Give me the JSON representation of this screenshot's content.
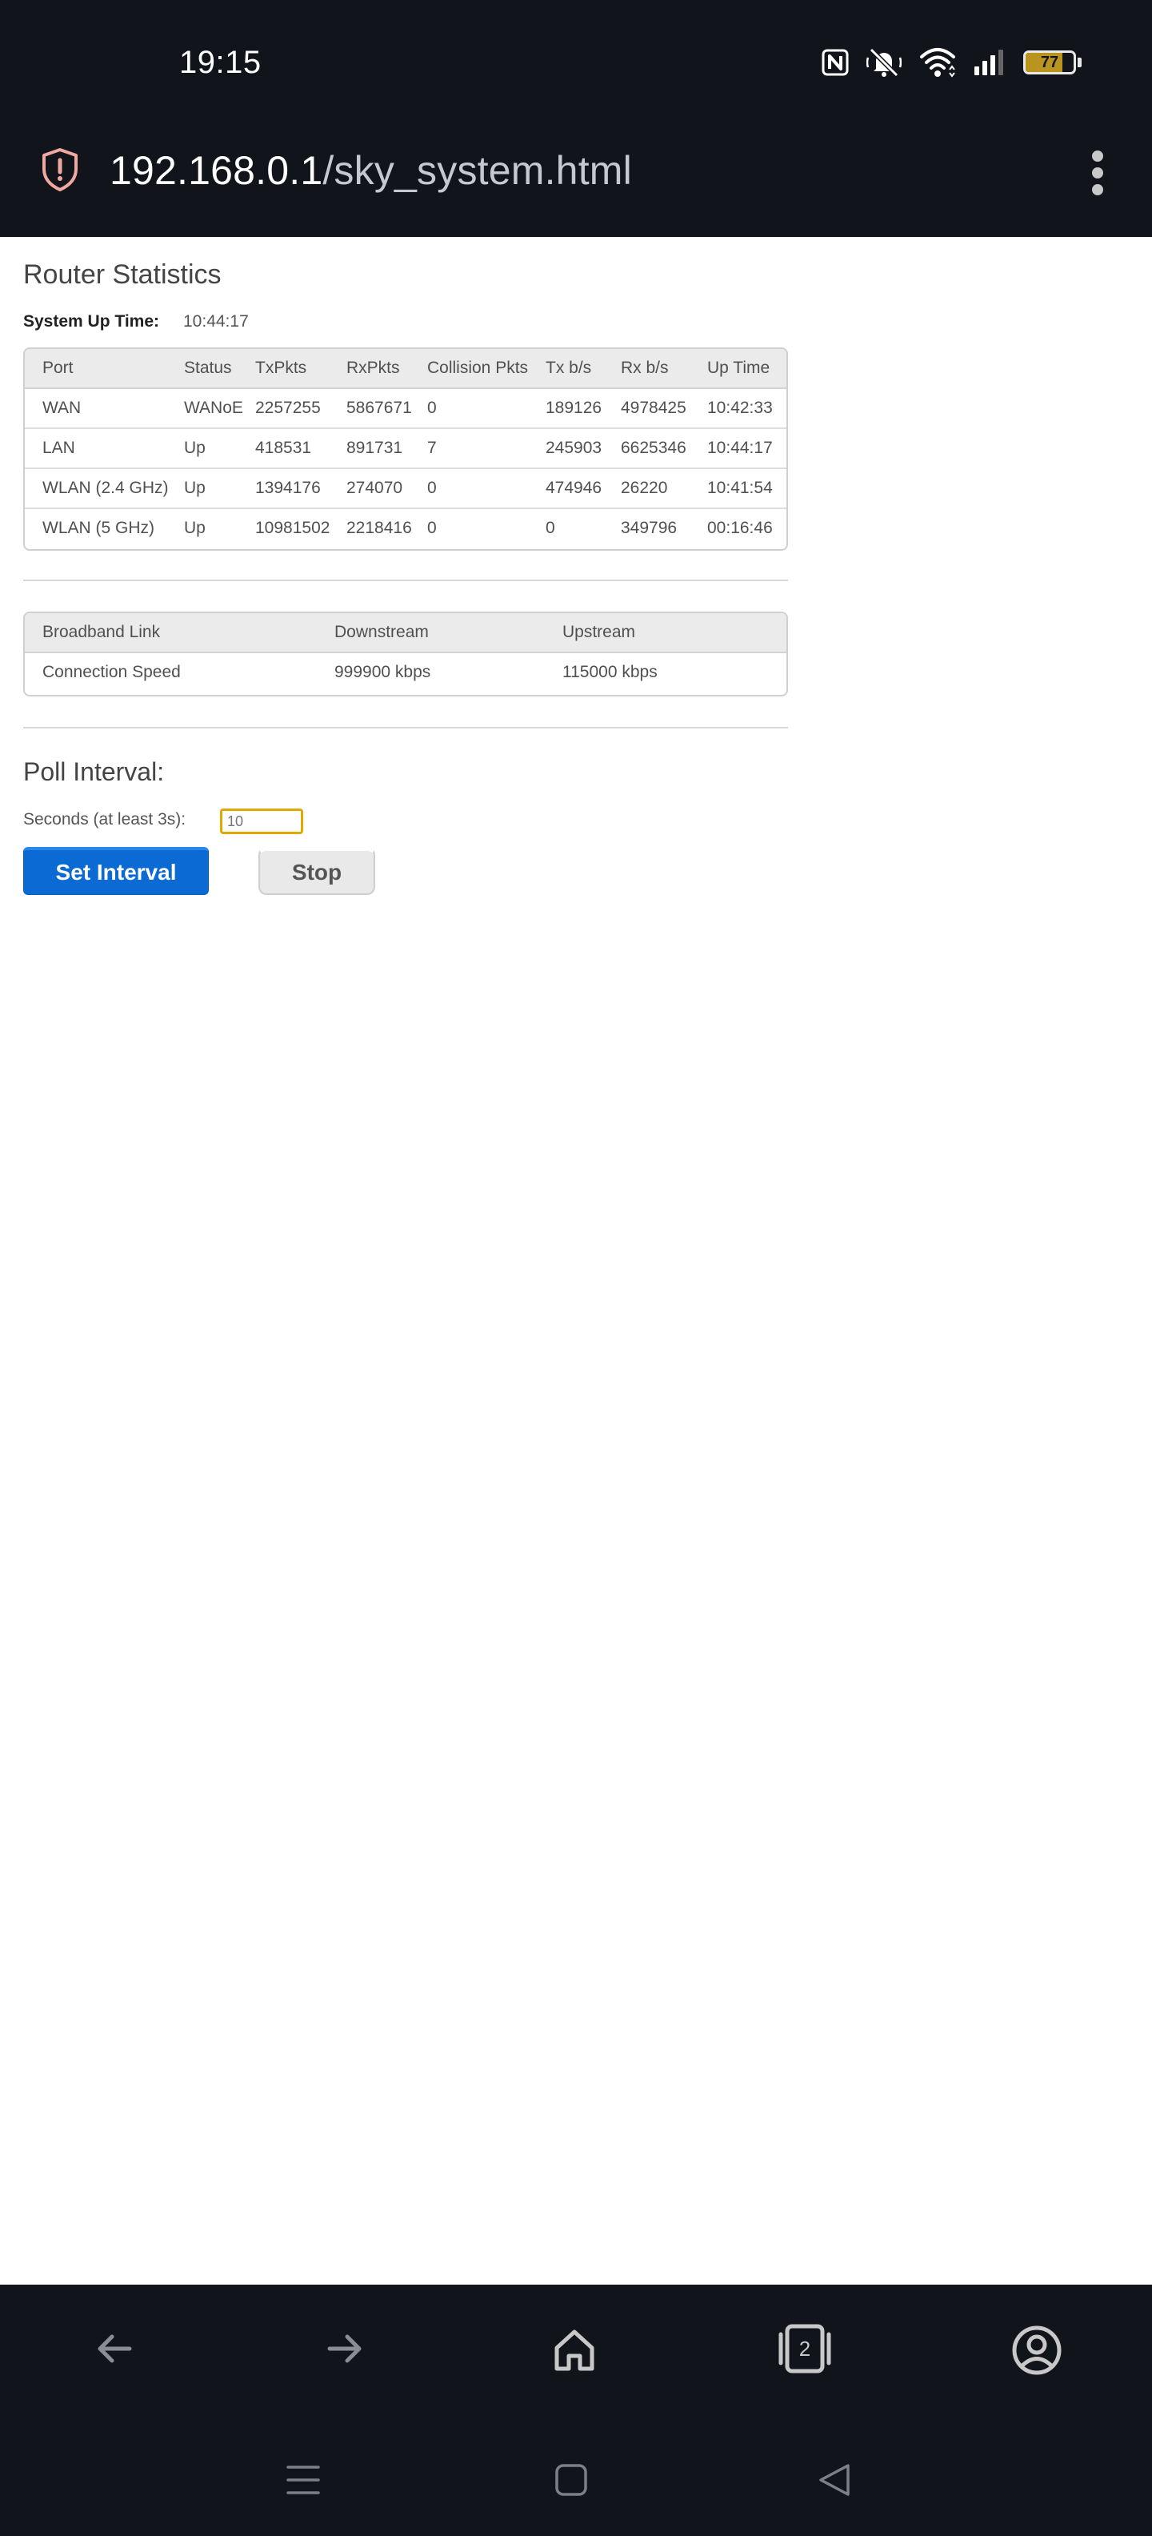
{
  "status_bar": {
    "time": "19:15",
    "battery_level": "77",
    "battery_fraction": 0.77,
    "icons": [
      "nfc-icon",
      "bell-muted-icon",
      "wifi-icon",
      "signal-icon",
      "battery-icon"
    ]
  },
  "browser": {
    "url_host": "192.168.0.1",
    "url_path": "/sky_system.html",
    "security_icon": "shield-alert-icon",
    "menu_icon": "kebab-menu-icon"
  },
  "page": {
    "title": "Router Statistics",
    "uptime_label": "System Up Time:",
    "uptime_value": "10:44:17",
    "stats_table": {
      "headers": [
        "Port",
        "Status",
        "TxPkts",
        "RxPkts",
        "Collision Pkts",
        "Tx b/s",
        "Rx b/s",
        "Up Time"
      ],
      "rows": [
        [
          "WAN",
          "WANoE",
          "2257255",
          "5867671",
          "0",
          "189126",
          "4978425",
          "10:42:33"
        ],
        [
          "LAN",
          "Up",
          "418531",
          "891731",
          "7",
          "245903",
          "6625346",
          "10:44:17"
        ],
        [
          "WLAN (2.4 GHz)",
          "Up",
          "1394176",
          "274070",
          "0",
          "474946",
          "26220",
          "10:41:54"
        ],
        [
          "WLAN (5 GHz)",
          "Up",
          "10981502",
          "2218416",
          "0",
          "0",
          "349796",
          "00:16:46"
        ]
      ]
    },
    "broadband_table": {
      "headers": [
        "Broadband Link",
        "Downstream",
        "Upstream"
      ],
      "rows": [
        [
          "Connection Speed",
          "999900 kbps",
          "115000 kbps"
        ]
      ]
    },
    "poll": {
      "title": "Poll Interval:",
      "seconds_label": "Seconds (at least 3s):",
      "seconds_placeholder": "10",
      "set_button": "Set Interval",
      "stop_button": "Stop"
    }
  },
  "bottom_nav": {
    "tab_count": "2",
    "icons": [
      "back-arrow-icon",
      "forward-arrow-icon",
      "home-icon",
      "tabs-icon",
      "account-icon"
    ]
  },
  "system_nav": {
    "icons": [
      "recent-apps-icon",
      "home-square-icon",
      "back-triangle-icon"
    ]
  }
}
